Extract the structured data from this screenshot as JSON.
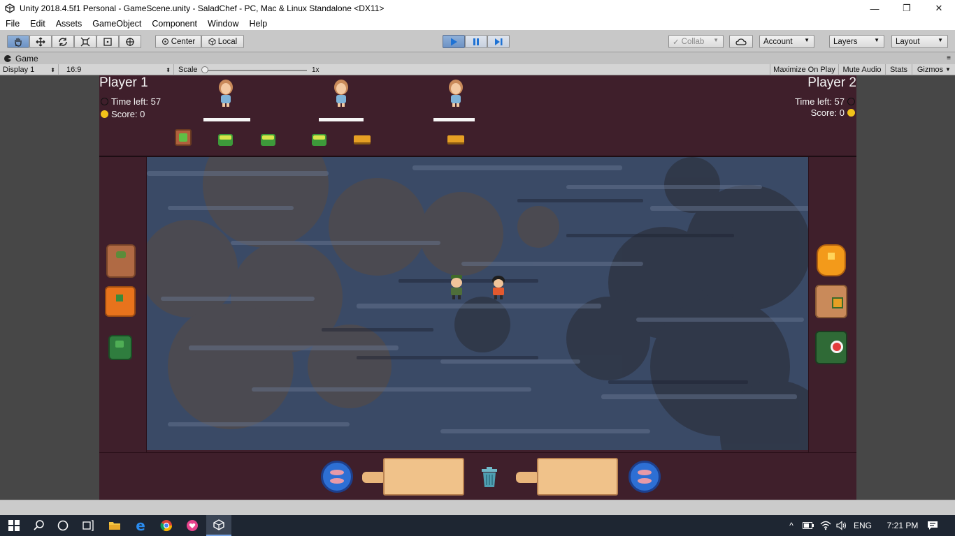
{
  "window": {
    "title": "Unity 2018.4.5f1 Personal - GameScene.unity - SaladChef - PC, Mac & Linux Standalone <DX11>",
    "minimize": "—",
    "maximize": "❐",
    "close": "✕"
  },
  "menu": [
    "File",
    "Edit",
    "Assets",
    "GameObject",
    "Component",
    "Window",
    "Help"
  ],
  "toolbar": {
    "pivot_center": "Center",
    "pivot_local": "Local",
    "collab": "Collab",
    "account": "Account",
    "layers": "Layers",
    "layout": "Layout",
    "play_active": true
  },
  "game_tab": {
    "label": "Game",
    "display": "Display 1",
    "aspect": "16:9",
    "scale_label": "Scale",
    "scale_value": "1x",
    "maximize_on_play": "Maximize On Play",
    "mute_audio": "Mute Audio",
    "stats": "Stats",
    "gizmos": "Gizmos"
  },
  "player1": {
    "name": "Player 1",
    "time_left": "Time left: 57",
    "score": "Score: 0"
  },
  "player2": {
    "name": "Player 2",
    "time_left": "Time left: 57",
    "score": "Score: 0"
  },
  "customers": [
    {
      "wait_bar": 1.0
    },
    {
      "wait_bar": 0.96
    },
    {
      "wait_bar": 0.9
    }
  ],
  "colors": {
    "game_bg": "#3f1f2b",
    "floor": "#3a4a66",
    "play_button": "#1e72d4",
    "taskbar": "#1e2632"
  },
  "taskbar": {
    "language": "ENG",
    "time": "7:21 PM"
  }
}
